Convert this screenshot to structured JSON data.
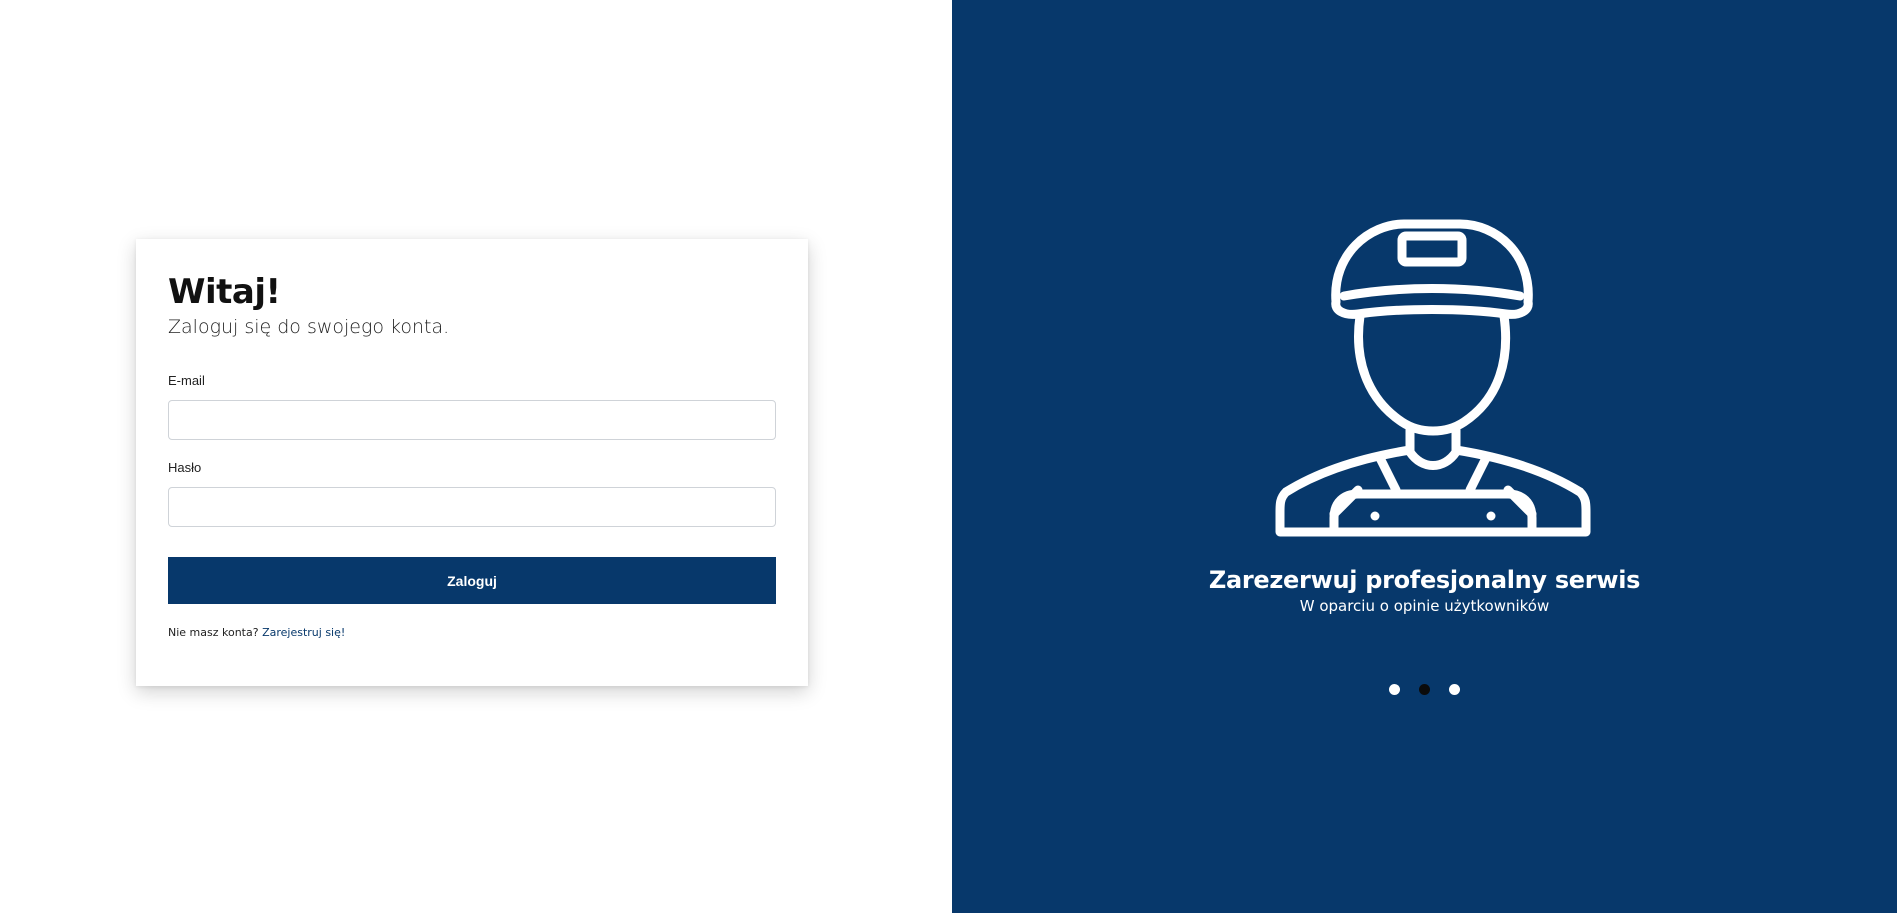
{
  "login": {
    "title": "Witaj!",
    "subtitle": "Zaloguj się do swojego konta.",
    "email_label": "E-mail",
    "email_value": "",
    "password_label": "Hasło",
    "password_value": "",
    "submit_label": "Zaloguj",
    "register_prompt": "Nie masz konta?",
    "register_link": "Zarejestruj się!"
  },
  "promo": {
    "icon": "mechanic-worker-icon",
    "title": "Zarezerwuj profesjonalny serwis",
    "subtitle": "W oparciu o opinie użytkowników",
    "slides": 3,
    "active_slide": 2
  },
  "colors": {
    "brand": "#07386b",
    "background": "#ffffff",
    "active_dot": "#0b0b0b"
  }
}
